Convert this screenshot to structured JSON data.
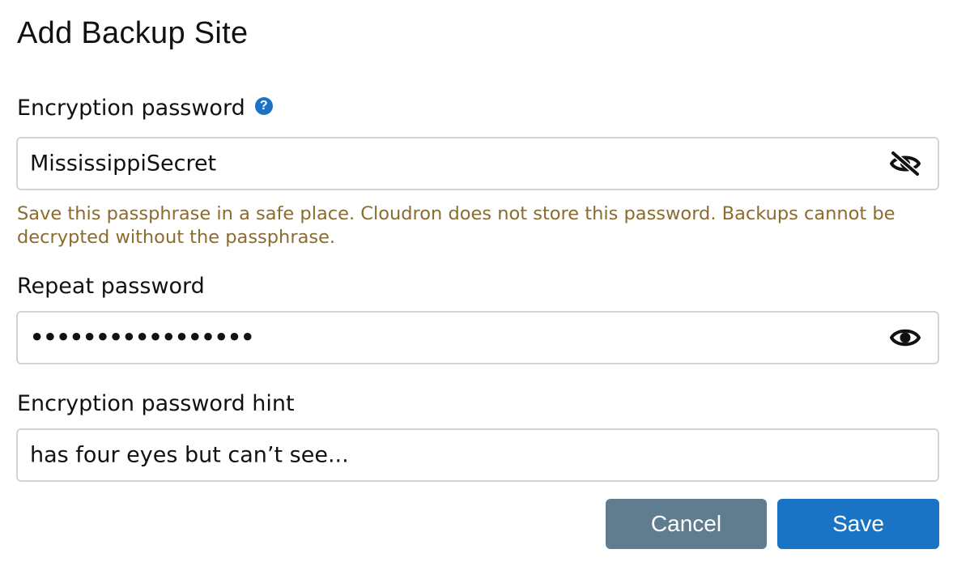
{
  "dialog": {
    "title": "Add Backup Site"
  },
  "encryption_password": {
    "label": "Encryption password",
    "help_icon": "question-circle-icon",
    "value": "MississippiSecret",
    "toggle_icon": "eye-slash-icon"
  },
  "warning": {
    "text": "Save this passphrase in a safe place. Cloudron does not store this password. Backups cannot be decrypted without the passphrase."
  },
  "repeat_password": {
    "label": "Repeat password",
    "value": "•••••••••••••••••",
    "toggle_icon": "eye-icon"
  },
  "password_hint": {
    "label": "Encryption password hint",
    "value": "has four eyes but can’t see..."
  },
  "buttons": {
    "cancel_label": "Cancel",
    "save_label": "Save"
  },
  "colors": {
    "primary": "#1a74c5",
    "secondary": "#607d8f",
    "warning_text": "#8b6b2e",
    "border": "#cfd4d9"
  }
}
